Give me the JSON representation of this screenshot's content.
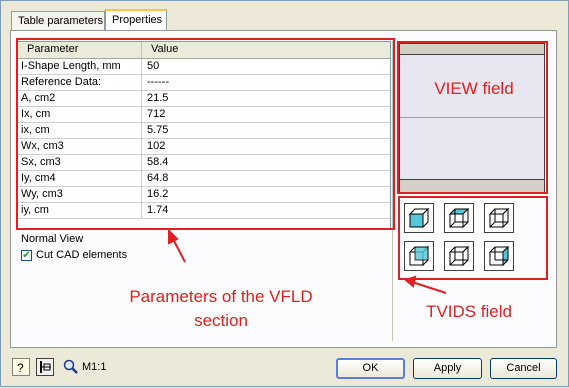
{
  "tabs": [
    {
      "label": "Table parameters",
      "active": false
    },
    {
      "label": "Properties",
      "active": true
    }
  ],
  "grid": {
    "columns": [
      "Parameter",
      "Value"
    ],
    "rows": [
      [
        "I-Shape Length, mm",
        "50"
      ],
      [
        "Reference Data:",
        "------"
      ],
      [
        "A, cm2",
        "21.5"
      ],
      [
        "Ix, cm",
        "712"
      ],
      [
        "ix, cm",
        "5.75"
      ],
      [
        "Wx, cm3",
        "102"
      ],
      [
        "Sx, cm3",
        "58.4"
      ],
      [
        "Iy, cm4",
        "64.8"
      ],
      [
        "Wy, cm3",
        "16.2"
      ],
      [
        "iy, cm",
        "1.74"
      ]
    ]
  },
  "view_mode": "Normal View",
  "cut_cad": {
    "label": "Cut CAD elements",
    "checked": true
  },
  "annotations": {
    "view_field": "VIEW field",
    "params_line1": "Parameters of the VFLD",
    "params_line2": "section",
    "tvids_field": "TVIDS field",
    "color": "#e02020"
  },
  "toolbar": {
    "scale": "M1:1"
  },
  "buttons": {
    "ok": "OK",
    "apply": "Apply",
    "cancel": "Cancel"
  }
}
